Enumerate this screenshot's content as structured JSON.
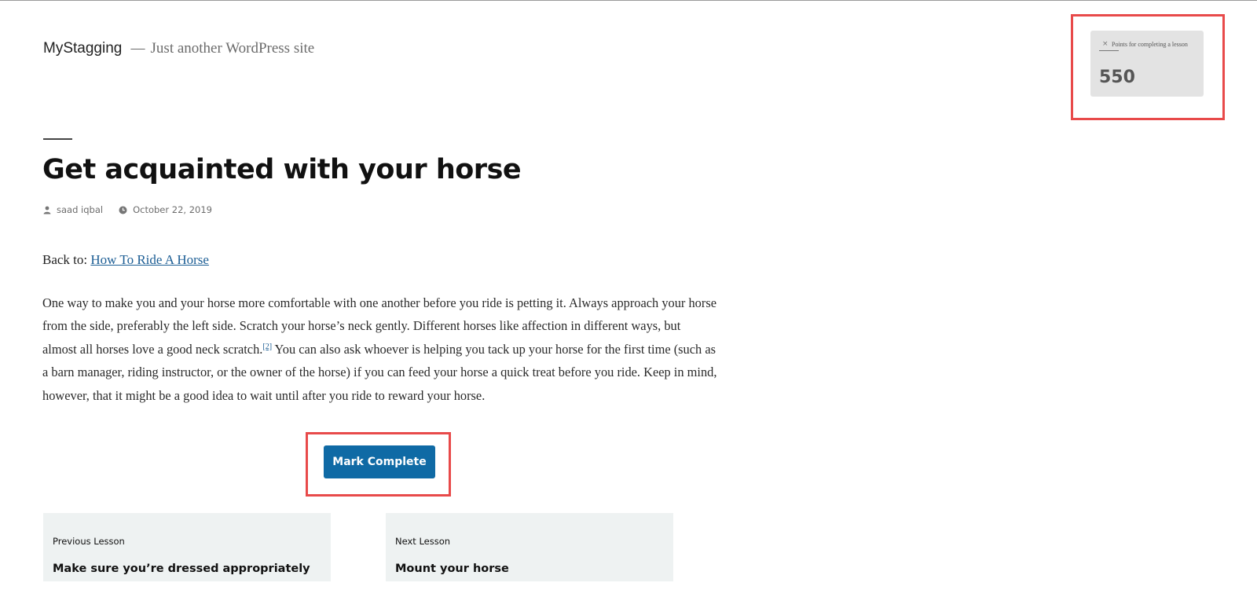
{
  "site": {
    "title": "MyStagging",
    "separator": "—",
    "description": "Just another WordPress site"
  },
  "post": {
    "title": "Get acquainted with your horse",
    "author": "saad iqbal",
    "date": "October 22, 2019",
    "author_icon": "person-icon",
    "date_icon": "clock-icon"
  },
  "breadcrumb": {
    "prefix": "Back to:",
    "link_text": "How To Ride A Horse"
  },
  "content": {
    "paragraph_part1": " One way to make you and your horse more comfortable with one another before you ride is petting it. Always approach your horse from the side, preferably the left side. Scratch your horse’s neck gently. Different horses like affection in different ways, but almost all horses love a good neck scratch.",
    "footnote": "[2]",
    "paragraph_part2": " You can also ask whoever is helping you tack up your horse for the first time (such as a barn manager, riding instructor, or the owner of the horse) if you can feed your horse a quick treat before you ride. Keep in mind, however, that it might be a good idea to wait until after you ride to reward your horse."
  },
  "actions": {
    "mark_complete_label": "Mark Complete"
  },
  "points_widget": {
    "close_glyph": "×",
    "label": "Points for completing a lesson",
    "value": "550"
  },
  "navigation": {
    "previous": {
      "kicker": "Previous Lesson",
      "title": "Make sure you’re dressed appropriately"
    },
    "next": {
      "kicker": "Next Lesson",
      "title": "Mount your horse"
    }
  },
  "colors": {
    "primary_button": "#0f6aa5",
    "highlight_box": "#e84a4a",
    "link": "#1b5d94",
    "nav_card_bg": "#eef2f2",
    "widget_bg": "#e3e3e3"
  }
}
